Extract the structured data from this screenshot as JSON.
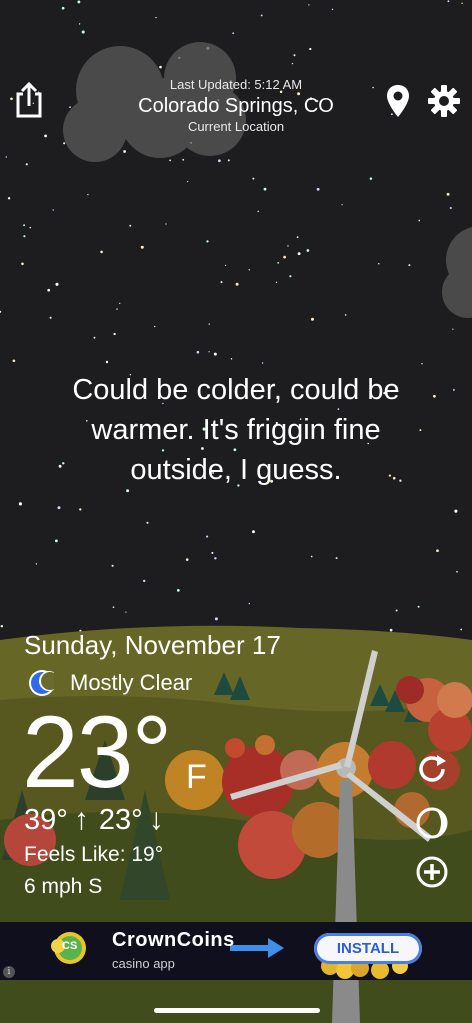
{
  "header": {
    "last_updated": "Last Updated: 5:12 AM",
    "city": "Colorado Springs, CO",
    "location_label": "Current Location"
  },
  "quote": {
    "line1": "Could be colder, could be",
    "line2": "warmer. It's friggin fine",
    "line3": "outside, I guess."
  },
  "weather": {
    "date": "Sunday, November 17",
    "condition_icon": "crescent-moon-icon",
    "condition": "Mostly Clear",
    "temperature": "23°",
    "unit": "F",
    "high": "39°",
    "high_arrow": "↑",
    "low": "23°",
    "low_arrow": "↓",
    "feels_like": "Feels Like: 19°",
    "wind": "6 mph S"
  },
  "ad": {
    "name": "CrownCoins",
    "subtitle": "casino app",
    "logo_text": "CS",
    "install_label": "INSTALL",
    "info_glyph": "i"
  },
  "icons": {
    "share": "share-icon",
    "location": "location-pin-icon",
    "settings": "gear-icon",
    "refresh": "refresh-icon",
    "moon_phase": "moon-phase-icon",
    "add": "plus-circle-icon"
  },
  "colors": {
    "sky": "#1d1d1f",
    "hills": "#6b6a2c",
    "foreground": "#3d4a1c",
    "accent_ad_button": "#2b5fd0",
    "moon": "#2f6be6"
  }
}
